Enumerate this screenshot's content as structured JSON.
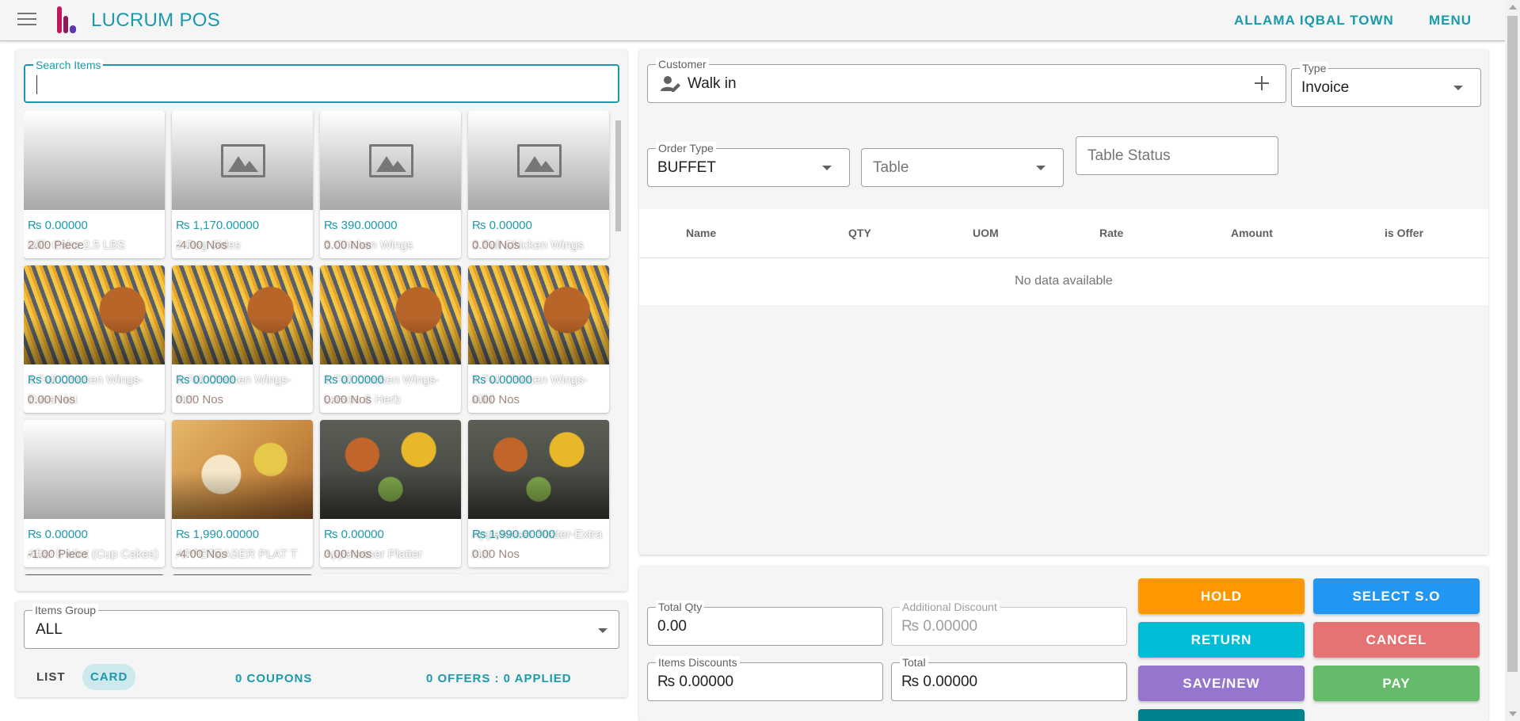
{
  "header": {
    "brand_name": "LUCRUM",
    "brand_suffix": "POS",
    "location": "ALLAMA IQBAL TOWN",
    "menu": "MENU"
  },
  "search": {
    "label": "Search Items",
    "value": ""
  },
  "items": [
    {
      "name": "Milk Cake 2.5 LBS",
      "price": "₨ 0.00000",
      "qty": "2.00 Piece",
      "image": "none"
    },
    {
      "name": "2 Reg Sides",
      "price": "₨ 1,170.00000",
      "qty": "-4.00 Nos",
      "image": "placeholder"
    },
    {
      "name": "3 Chicken Wings",
      "price": "₨ 390.00000",
      "qty": "0.00 Nos",
      "image": "placeholder"
    },
    {
      "name": "3 Full Chicken Wings",
      "price": "₨ 0.00000",
      "qty": "0.00 Nos",
      "image": "placeholder"
    },
    {
      "name": "3 Full Chicken Wings-Extra Hot",
      "price": "₨ 0.00000",
      "qty": "0.00 Nos",
      "image": "wings"
    },
    {
      "name": "3 Full Chicken Wings-Hot",
      "price": "₨ 0.00000",
      "qty": "0.00 Nos",
      "image": "wings"
    },
    {
      "name": "3 Full Chicken Wings-Lemon & Herb",
      "price": "₨ 0.00000",
      "qty": "0.00 Nos",
      "image": "wings"
    },
    {
      "name": "3 Full Chicken Wings-Mild",
      "price": "₨ 0.00000",
      "qty": "0.00 Nos",
      "image": "wings"
    },
    {
      "name": "After 8 Mint (Cup Cakes)",
      "price": "₨ 0.00000",
      "qty": "-1.00 Piece",
      "image": "none"
    },
    {
      "name": "APPETEASER PLAT T",
      "price": "₨ 1,990.00000",
      "qty": "-4.00 Nos",
      "image": "sandwich"
    },
    {
      "name": "Appeteaser Platter",
      "price": "₨ 0.00000",
      "qty": "0.00 Nos",
      "image": "platter"
    },
    {
      "name": "Appeteaser Platter-Extra Hot",
      "price": "₨ 1,990.00000",
      "qty": "0.00 Nos",
      "image": "platter"
    }
  ],
  "items_group": {
    "label": "Items Group",
    "value": "ALL"
  },
  "view_tabs": {
    "list": "LIST",
    "card": "CARD"
  },
  "coupons": "0 COUPONS",
  "offers": "0 OFFERS : 0 APPLIED",
  "customer": {
    "label": "Customer",
    "value": "Walk in"
  },
  "type": {
    "label": "Type",
    "value": "Invoice"
  },
  "order_type": {
    "label": "Order Type",
    "value": "BUFFET"
  },
  "table": {
    "placeholder": "Table"
  },
  "table_status": {
    "placeholder": "Table Status"
  },
  "items_table": {
    "columns": [
      "Name",
      "QTY",
      "UOM",
      "Rate",
      "Amount",
      "is Offer"
    ],
    "empty_text": "No data available"
  },
  "totals": {
    "total_qty_label": "Total Qty",
    "total_qty": "0.00",
    "additional_discount_label": "Additional Discount",
    "additional_discount": "₨ 0.00000",
    "items_discounts_label": "Items Discounts",
    "items_discounts": "₨ 0.00000",
    "total_label": "Total",
    "total": "₨ 0.00000"
  },
  "actions": {
    "hold": "HOLD",
    "select_so": "SELECT S.O",
    "return": "RETURN",
    "cancel": "CANCEL",
    "save_new": "SAVE/NEW",
    "pay": "PAY"
  },
  "colors": {
    "accent": "#1a9aaa",
    "hold": "#ff9800",
    "select_so": "#2196f3",
    "return": "#00bcd4",
    "cancel": "#e57373",
    "save_new": "#9575cd",
    "pay": "#66bb6a"
  }
}
